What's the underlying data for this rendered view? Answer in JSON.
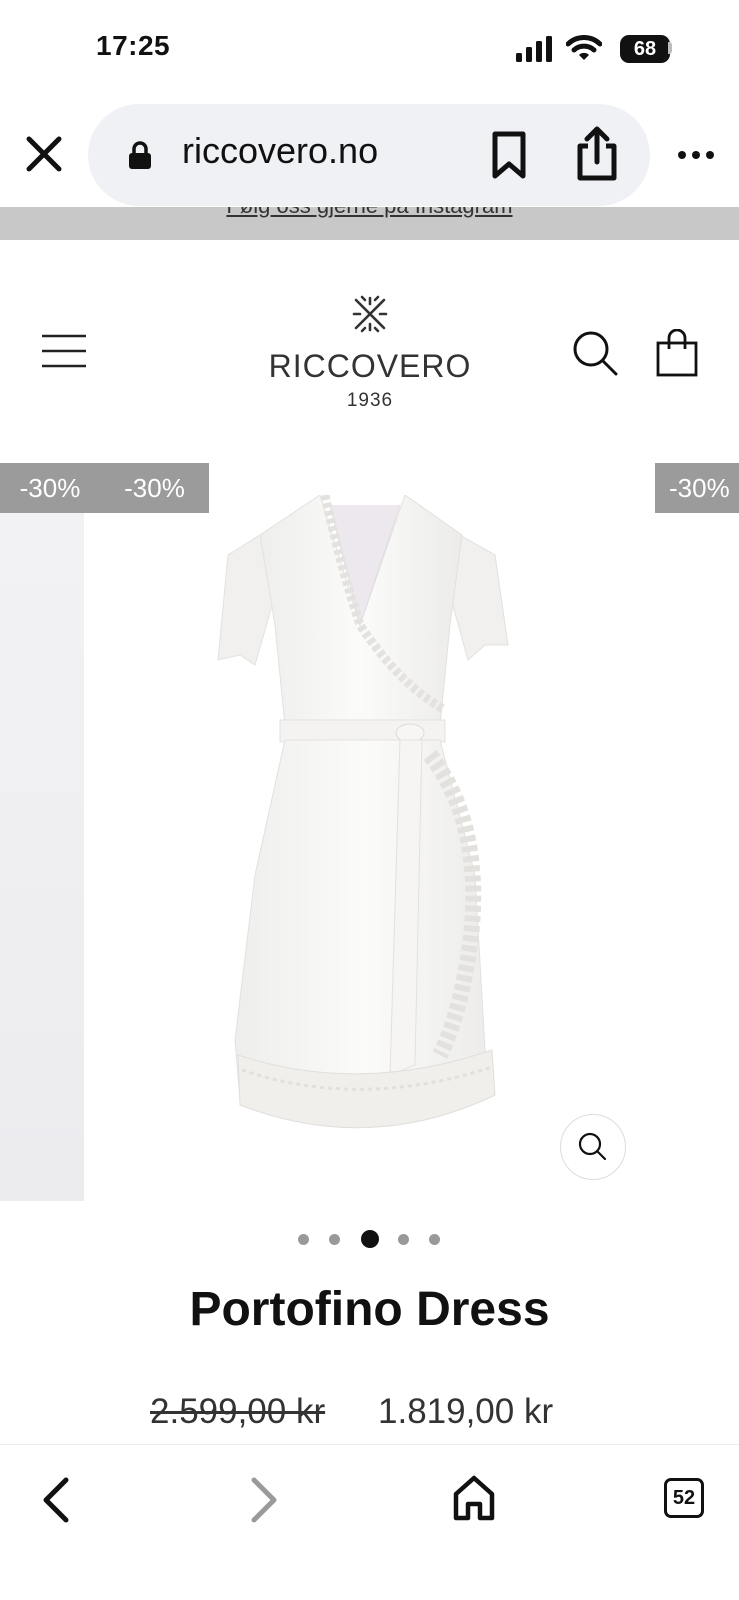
{
  "status_bar": {
    "time": "17:25",
    "battery": "68"
  },
  "browser": {
    "url": "riccovero.no",
    "icons": [
      "close-icon",
      "lock-icon",
      "bookmark-icon",
      "share-icon",
      "more-icon"
    ]
  },
  "announcement": {
    "text": "Følg oss gjerne på Instagram"
  },
  "header": {
    "brand": "RICCOVERO",
    "year": "1936",
    "icons": [
      "menu-icon",
      "search-icon",
      "bag-icon"
    ]
  },
  "gallery": {
    "badges": [
      "-30%",
      "-30%",
      "-30%"
    ],
    "slide_count": 5,
    "active_slide": 3
  },
  "product": {
    "title": "Portofino Dress",
    "price_old": "2.599,00 kr",
    "price_new": "1.819,00 kr"
  },
  "toolbar": {
    "tabs_count": "52"
  },
  "colors": {
    "badge": "#9b9b9b",
    "text": "#111111",
    "url_pill": "#f0f1f4"
  }
}
